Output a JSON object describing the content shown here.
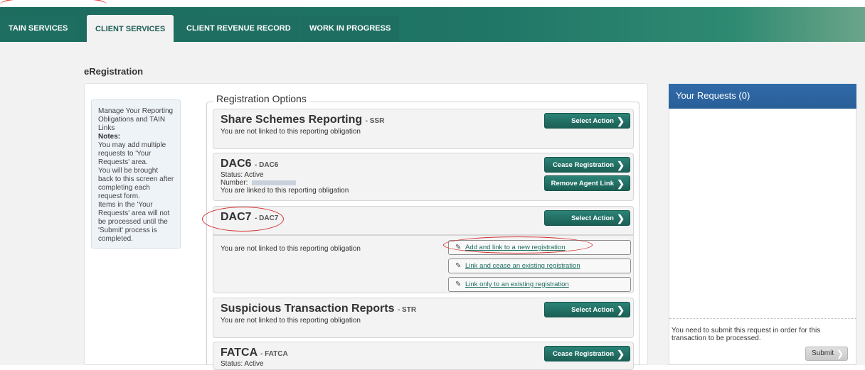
{
  "nav": {
    "tabs": [
      {
        "label": "TAIN SERVICES"
      },
      {
        "label": "CLIENT SERVICES"
      },
      {
        "label": "CLIENT REVENUE RECORD"
      },
      {
        "label": "WORK IN PROGRESS"
      }
    ],
    "active_tab": "CLIENT SERVICES"
  },
  "page": {
    "title": "eRegistration"
  },
  "notes": {
    "intro": "Manage Your Reporting Obligations and TAIN Links",
    "heading": "Notes:",
    "lines": [
      "You may add multiple requests to 'Your Requests' area.",
      "You will be brought back to this screen after completing each request form.",
      "Items in the 'Your Requests' area will not be processed until the 'Submit' process is completed."
    ]
  },
  "registration": {
    "legend": "Registration Options",
    "cards": [
      {
        "name": "Share Schemes Reporting",
        "code": "- SSR",
        "status_line": "You are not linked to this reporting obligation",
        "buttons": [
          "Select Action"
        ]
      },
      {
        "name": "DAC6",
        "code": "- DAC6",
        "status": "Status: Active",
        "number_label": "Number:",
        "status_line": "You are linked to this reporting obligation",
        "buttons": [
          "Cease Registration",
          "Remove Agent Link"
        ]
      },
      {
        "name": "DAC7",
        "code": "- DAC7",
        "status_line": "You are not linked to this reporting obligation",
        "buttons": [
          "Select Action"
        ],
        "options": [
          "Add and link to a new registration",
          "Link and cease an existing registration",
          "Link only to an existing registration"
        ]
      },
      {
        "name": "Suspicious Transaction Reports",
        "code": "- STR",
        "status_line": "You are not linked to this reporting obligation",
        "buttons": [
          "Select Action"
        ]
      },
      {
        "name": "FATCA",
        "code": "- FATCA",
        "status": "Status: Active",
        "buttons": [
          "Cease Registration"
        ]
      }
    ]
  },
  "requests": {
    "title": "Your Requests (0)",
    "note": "You need to submit this request in order for this transaction to be processed.",
    "submit_label": "Submit"
  },
  "colors": {
    "nav_green": "#1e6e61",
    "button_green": "#1b5f55",
    "requests_header_blue": "#2f6aa8",
    "highlight_red": "#d32f2f"
  }
}
